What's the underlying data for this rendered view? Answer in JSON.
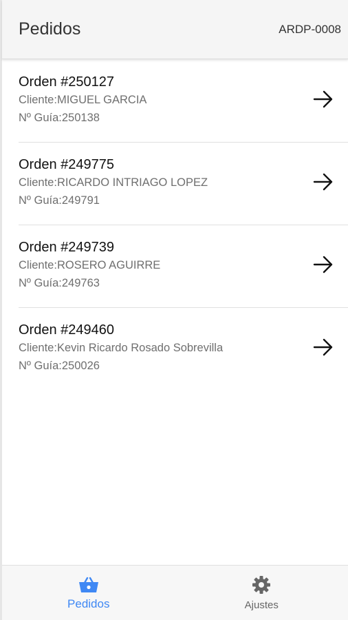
{
  "header": {
    "title": "Pedidos",
    "code": "ARDP-0008"
  },
  "orders": [
    {
      "title": "Orden #250127",
      "cliente": "Cliente:MIGUEL GARCIA",
      "guia": "Nº Guía:250138"
    },
    {
      "title": "Orden #249775",
      "cliente": "Cliente:RICARDO INTRIAGO LOPEZ",
      "guia": "Nº Guía:249791"
    },
    {
      "title": "Orden #249739",
      "cliente": "Cliente:ROSERO AGUIRRE",
      "guia": "Nº Guía:249763"
    },
    {
      "title": "Orden #249460",
      "cliente": "Cliente:Kevin Ricardo Rosado Sobrevilla",
      "guia": "Nº Guía:250026"
    }
  ],
  "nav": {
    "items": [
      {
        "label": "Pedidos",
        "icon": "basket-icon",
        "active": true
      },
      {
        "label": "Ajustes",
        "icon": "gear-icon",
        "active": false
      }
    ]
  },
  "colors": {
    "accent": "#3f88f4",
    "inactive": "#666666",
    "header_bg": "#f5f5f5"
  }
}
